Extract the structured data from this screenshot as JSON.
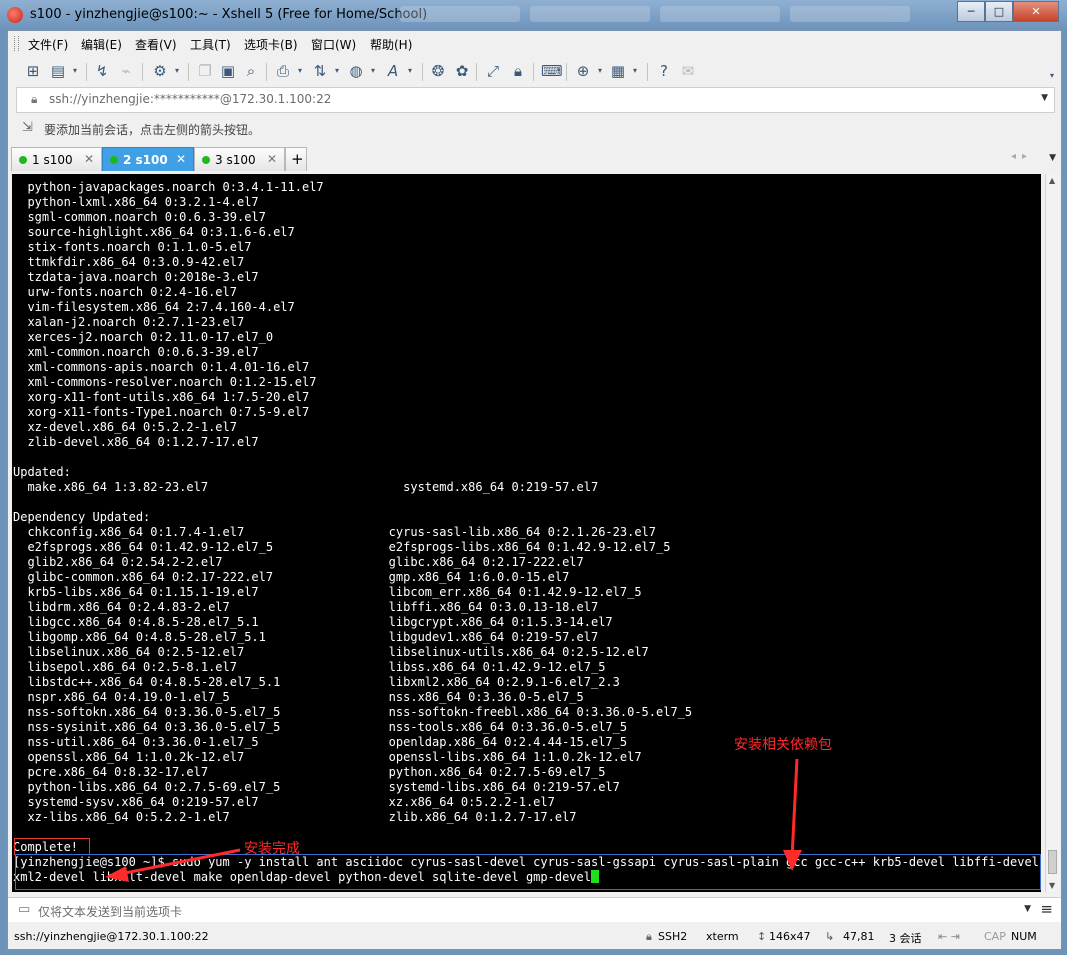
{
  "window": {
    "title": "s100 - yinzhengjie@s100:~ - Xshell 5 (Free for Home/School)",
    "controls": [
      "─",
      "□",
      "✕"
    ]
  },
  "menu": [
    "文件(F)",
    "编辑(E)",
    "查看(V)",
    "工具(T)",
    "选项卡(B)",
    "窗口(W)",
    "帮助(H)"
  ],
  "address_bar": {
    "value": "ssh://yinzhengjie:***********@172.30.1.100:22"
  },
  "hint_bar": {
    "text": "要添加当前会话，点击左侧的箭头按钮。"
  },
  "tabs": [
    {
      "label": "1 s100",
      "active": false
    },
    {
      "label": "2 s100",
      "active": true
    },
    {
      "label": "3 s100",
      "active": false
    }
  ],
  "tab_close": "✕",
  "tab_add": "+",
  "terminal": {
    "lines": [
      "  python-javapackages.noarch 0:3.4.1-11.el7",
      "  python-lxml.x86_64 0:3.2.1-4.el7",
      "  sgml-common.noarch 0:0.6.3-39.el7",
      "  source-highlight.x86_64 0:3.1.6-6.el7",
      "  stix-fonts.noarch 0:1.1.0-5.el7",
      "  ttmkfdir.x86_64 0:3.0.9-42.el7",
      "  tzdata-java.noarch 0:2018e-3.el7",
      "  urw-fonts.noarch 0:2.4-16.el7",
      "  vim-filesystem.x86_64 2:7.4.160-4.el7",
      "  xalan-j2.noarch 0:2.7.1-23.el7",
      "  xerces-j2.noarch 0:2.11.0-17.el7_0",
      "  xml-common.noarch 0:0.6.3-39.el7",
      "  xml-commons-apis.noarch 0:1.4.01-16.el7",
      "  xml-commons-resolver.noarch 0:1.2-15.el7",
      "  xorg-x11-font-utils.x86_64 1:7.5-20.el7",
      "  xorg-x11-fonts-Type1.noarch 0:7.5-9.el7",
      "  xz-devel.x86_64 0:5.2.2-1.el7",
      "  zlib-devel.x86_64 0:1.2.7-17.el7",
      "",
      "Updated:",
      "  make.x86_64 1:3.82-23.el7                           systemd.x86_64 0:219-57.el7",
      "",
      "Dependency Updated:",
      "  chkconfig.x86_64 0:1.7.4-1.el7                    cyrus-sasl-lib.x86_64 0:2.1.26-23.el7",
      "  e2fsprogs.x86_64 0:1.42.9-12.el7_5                e2fsprogs-libs.x86_64 0:1.42.9-12.el7_5",
      "  glib2.x86_64 0:2.54.2-2.el7                       glibc.x86_64 0:2.17-222.el7",
      "  glibc-common.x86_64 0:2.17-222.el7                gmp.x86_64 1:6.0.0-15.el7",
      "  krb5-libs.x86_64 0:1.15.1-19.el7                  libcom_err.x86_64 0:1.42.9-12.el7_5",
      "  libdrm.x86_64 0:2.4.83-2.el7                      libffi.x86_64 0:3.0.13-18.el7",
      "  libgcc.x86_64 0:4.8.5-28.el7_5.1                  libgcrypt.x86_64 0:1.5.3-14.el7",
      "  libgomp.x86_64 0:4.8.5-28.el7_5.1                 libgudev1.x86_64 0:219-57.el7",
      "  libselinux.x86_64 0:2.5-12.el7                    libselinux-utils.x86_64 0:2.5-12.el7",
      "  libsepol.x86_64 0:2.5-8.1.el7                     libss.x86_64 0:1.42.9-12.el7_5",
      "  libstdc++.x86_64 0:4.8.5-28.el7_5.1               libxml2.x86_64 0:2.9.1-6.el7_2.3",
      "  nspr.x86_64 0:4.19.0-1.el7_5                      nss.x86_64 0:3.36.0-5.el7_5",
      "  nss-softokn.x86_64 0:3.36.0-5.el7_5               nss-softokn-freebl.x86_64 0:3.36.0-5.el7_5",
      "  nss-sysinit.x86_64 0:3.36.0-5.el7_5               nss-tools.x86_64 0:3.36.0-5.el7_5",
      "  nss-util.x86_64 0:3.36.0-1.el7_5                  openldap.x86_64 0:2.4.44-15.el7_5",
      "  openssl.x86_64 1:1.0.2k-12.el7                    openssl-libs.x86_64 1:1.0.2k-12.el7",
      "  pcre.x86_64 0:8.32-17.el7                         python.x86_64 0:2.7.5-69.el7_5",
      "  python-libs.x86_64 0:2.7.5-69.el7_5               systemd-libs.x86_64 0:219-57.el7",
      "  systemd-sysv.x86_64 0:219-57.el7                  xz.x86_64 0:5.2.2-1.el7",
      "  xz-libs.x86_64 0:5.2.2-1.el7                      zlib.x86_64 0:1.2.7-17.el7",
      "",
      "Complete!",
      "[yinzhengjie@s100 ~]$ sudo yum -y install ant asciidoc cyrus-sasl-devel cyrus-sasl-gssapi cyrus-sasl-plain gcc gcc-c++ krb5-devel libffi-devel lib",
      "xml2-devel libxslt-devel make openldap-devel python-devel sqlite-devel gmp-devel"
    ]
  },
  "annotations": {
    "deps_label": "安装相关依赖包",
    "complete_label": "安装完成"
  },
  "send_bar": {
    "placeholder": "仅将文本发送到当前选项卡"
  },
  "status_bar": {
    "connection": "ssh://yinzhengjie@172.30.1.100:22",
    "protocol": "SSH2",
    "terminal_type": "xterm",
    "size": "146x47",
    "cursor_pos": "47,81",
    "sessions": "3 会话",
    "caps": "CAP",
    "num": "NUM"
  }
}
